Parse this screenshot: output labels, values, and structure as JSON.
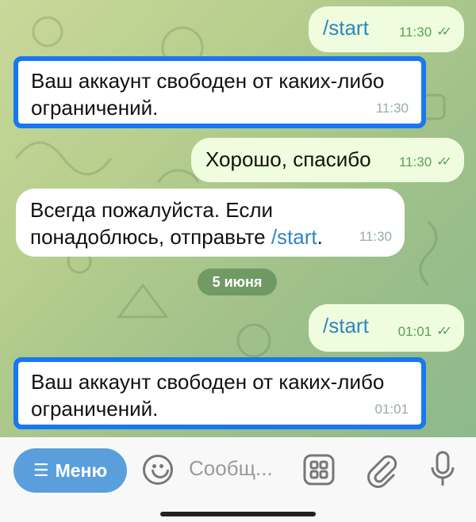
{
  "messages": [
    {
      "side": "out",
      "text": "/start",
      "time": "11:30"
    },
    {
      "side": "in",
      "text": "Ваш аккаунт свободен от каких-либо ограничений.",
      "time": "11:30"
    },
    {
      "side": "out",
      "text": "Хорошо, спасибо",
      "time": "11:30"
    },
    {
      "side": "in",
      "text_part1": "Всегда пожалуйста. Если понадоблюсь, отправьте ",
      "cmd": "/start",
      "text_part2": ".",
      "time": "11:30"
    },
    {
      "side": "out",
      "text": "/start",
      "time": "01:01"
    },
    {
      "side": "in",
      "text": "Ваш аккаунт свободен от каких-либо ограничений.",
      "time": "01:01"
    }
  ],
  "date_separator": "5 июня",
  "composer": {
    "menu_label": "Меню",
    "placeholder": "Сообщ..."
  },
  "colors": {
    "highlight": "#1877f2",
    "menu_button": "#5a9fdc",
    "outgoing_bubble": "#effdde",
    "incoming_bubble": "#ffffff"
  },
  "icons": [
    "menu-bars-icon",
    "emoji-icon",
    "keyboard-grid-icon",
    "attach-icon",
    "microphone-icon",
    "double-check-icon"
  ]
}
